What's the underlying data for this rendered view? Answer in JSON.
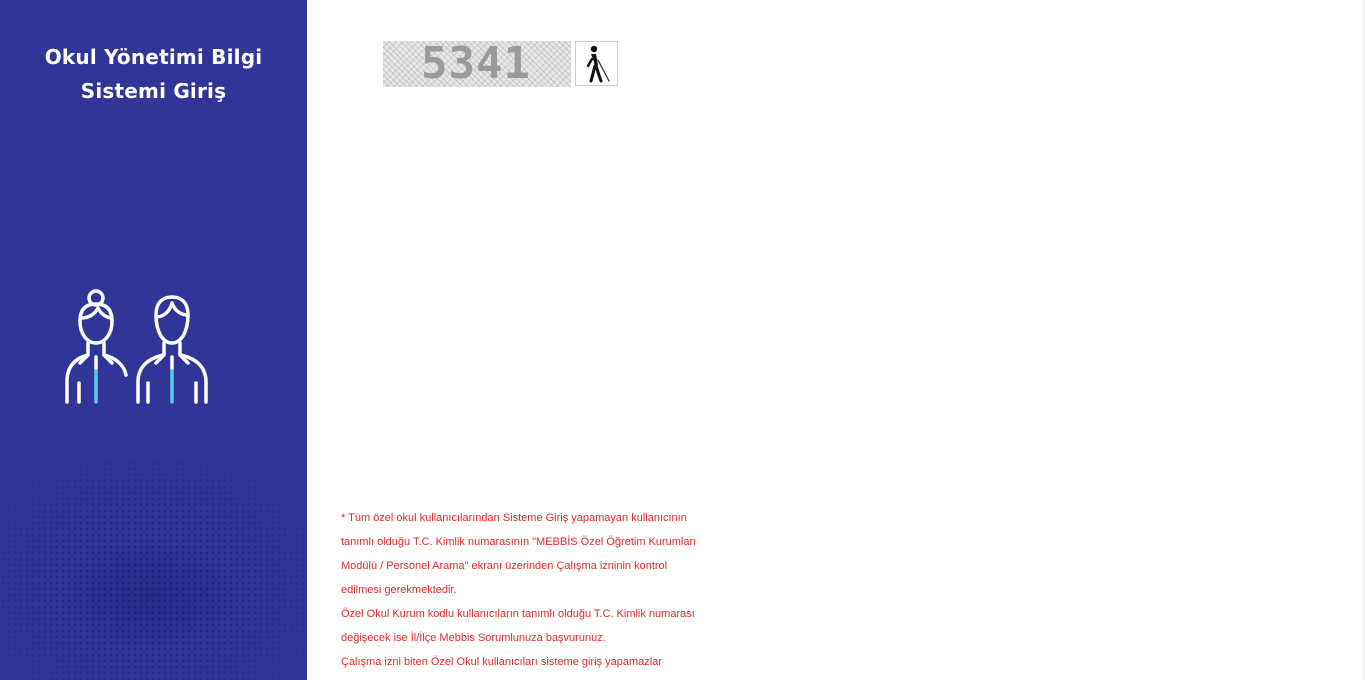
{
  "sidebar": {
    "title_line1": "Okul Yönetimi Bilgi",
    "title_line2": "Sistemi Giriş",
    "illustration_icon": "teachers-people-icon",
    "background_color": "#313598"
  },
  "captcha": {
    "code": "5341",
    "audio_icon": "blind-person-accessibility-icon"
  },
  "notice": {
    "color": "#e32a2a",
    "lines": [
      "* Tüm özel okul kullanıcılarından Sisteme Giriş yapamayan kullanıcının",
      "tanımlı olduğu T.C. Kimlik numarasının \"MEBBİS Özel Öğretim Kurumları",
      "Modülü / Personel Arama\" ekranı üzerinden Çalışma izninin kontrol",
      "edilmesi gerekmektedir.",
      "Özel Okul Kurum kodlu kullanıcıların tanımlı olduğu T.C. Kimlik numarası",
      "değişecek ise İl/İlçe Mebbis Sorumlunuza başvurunuz.",
      "Çalışma izni biten Özel Okul kullanıcıları sisteme giriş yapamazlar"
    ]
  }
}
